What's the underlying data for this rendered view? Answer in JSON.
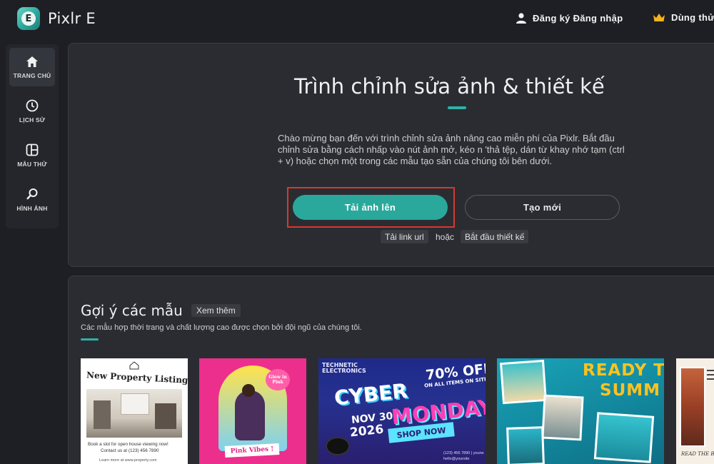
{
  "app": {
    "title": "Pixlr E",
    "logo_letter": "E"
  },
  "header": {
    "auth_label": "Đăng ký Đăng nhập",
    "trial_label": "Dùng thử"
  },
  "sidebar": {
    "items": [
      {
        "label": "TRANG CHỦ",
        "icon": "home-icon",
        "active": true
      },
      {
        "label": "LỊCH SỬ",
        "icon": "clock-icon",
        "active": false
      },
      {
        "label": "MẪU THỬ",
        "icon": "template-icon",
        "active": false
      },
      {
        "label": "HÌNH ẢNH",
        "icon": "search-icon",
        "active": false
      }
    ]
  },
  "hero": {
    "title": "Trình chỉnh sửa ảnh & thiết kế",
    "description": "Chào mừng bạn đến với trình chỉnh sửa ảnh nâng cao miễn phí của Pixlr. Bắt đầu chỉnh sửa bằng cách nhấp vào nút ảnh mở, kéo n 'thả tệp, dán từ khay nhớ tạm (ctrl + v) hoặc chọn một trong các mẫu tạo sẵn của chúng tôi bên dưới.",
    "upload_label": "Tải ảnh lên",
    "new_label": "Tạo mới",
    "url_link": "Tải link url",
    "or_text": "hoặc",
    "start_design": "Bắt đầu thiết kế"
  },
  "templates": {
    "title": "Gợi ý các mẫu",
    "see_more": "Xem thêm",
    "subtitle": "Các mẫu hợp thời trang và chất lượng cao được chọn bởi đội ngũ của chúng tôi.",
    "cards": {
      "property": {
        "title": "New Property Listing",
        "line1": "Book a slot for open house viewing now!",
        "line2": "Contact us at (123) 456 7890",
        "line3": "Learn more at www.property.com"
      },
      "pink": {
        "badge_line1": "Glow in",
        "badge_line2": "Pink",
        "caption": "Pink Vibes !"
      },
      "cyber": {
        "brand": "TECHNETIC ELECTRONICS",
        "discount": "70% OFF",
        "discount_sub": "ON ALL ITEMS ON SITE",
        "word1": "CYBER",
        "word2": "MONDAY",
        "date1": "NOV 30",
        "date2": "2026",
        "shop": "SHOP NOW",
        "contact": "(123) 456 7890 | yourw",
        "email": "hello@yoursite"
      },
      "summer": {
        "line1": "READY T",
        "line2": "SUMM"
      },
      "blog": {
        "caption": "READ THE BL"
      }
    }
  },
  "colors": {
    "accent": "#2aa89c",
    "highlight_frame": "#d23b2f",
    "background": "#1e1f24",
    "panel": "#2b2c32"
  }
}
